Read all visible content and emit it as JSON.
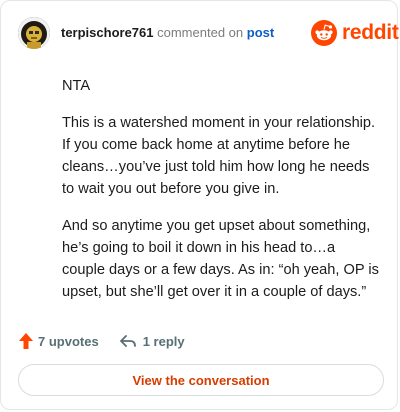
{
  "header": {
    "username": "terpischore761",
    "action_text": "commented on",
    "post_link": "post",
    "brand": "reddit",
    "brand_color": "#ff4500"
  },
  "avatar": {
    "icon": "robot-lion-avatar-icon"
  },
  "comment": {
    "paragraphs": [
      "NTA",
      "This is a watershed moment in your relationship. If you come back home at anytime before he cleans…you’ve just told him how long he needs to wait you out before you give in.",
      "And so anytime you get upset about something, he’s going to boil it down in his head to…a couple days or a few days. As in: “oh yeah, OP is upset, but she’ll get over it in a couple of days.”"
    ]
  },
  "footer": {
    "upvotes": "7 upvotes",
    "upvote_icon": "upvote-arrow-icon",
    "replies": "1 reply",
    "reply_icon": "reply-arrow-icon"
  },
  "cta": {
    "label": "View the conversation"
  }
}
